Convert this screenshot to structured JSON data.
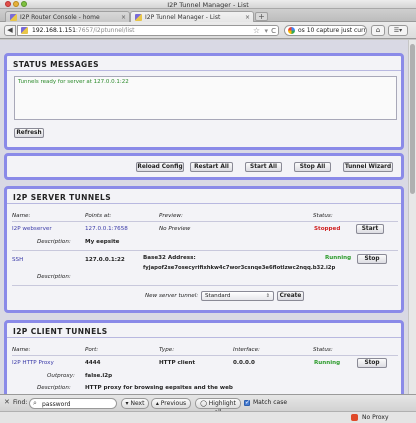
{
  "window": {
    "title": "I2P Tunnel Manager - List"
  },
  "tabs": [
    {
      "label": "I2P Router Console - home",
      "close": "×"
    },
    {
      "label": "I2P Tunnel Manager - List",
      "close": "×"
    }
  ],
  "new_tab": "+",
  "nav": {
    "back": "◀",
    "url_host": "192.168.1.151",
    "url_path": ":7657/i2ptunnel/list",
    "star": "☆",
    "arrow": "▾",
    "reload": "C",
    "search_text": "os 10 capture just curr",
    "home": "⌂",
    "menu": "☰▾"
  },
  "status": {
    "title": "STATUS MESSAGES",
    "message": "Tunnels ready for server at 127.0.0.1:22",
    "refresh": "Refresh"
  },
  "controls": {
    "buttons": [
      "Reload Config",
      "Restart All",
      "Start All",
      "Stop All",
      "Tunnel Wizard"
    ]
  },
  "server": {
    "title": "I2P SERVER TUNNELS",
    "headers": {
      "name": "Name:",
      "points": "Points at:",
      "preview": "Preview:",
      "status": "Status:"
    },
    "description_label": "Description:",
    "base32_label": "Base32 Address:",
    "rows": [
      {
        "name": "I2P webserver",
        "points": "127.0.0.1:7658",
        "preview": "No Preview",
        "status": "Stopped",
        "action": "Start",
        "description": "My eepsite"
      },
      {
        "name": "SSH",
        "points": "127.0.0.1:22",
        "status": "Running",
        "action": "Stop",
        "base32": "fyjapof2se7osecyrifixhkw4c7wor3csnqe3e6flotlzwc2nqq.b32.i2p",
        "description": ""
      }
    ],
    "new_label": "New server tunnel:",
    "new_select": "Standard",
    "create": "Create"
  },
  "client": {
    "title": "I2P CLIENT TUNNELS",
    "headers": {
      "name": "Name:",
      "port": "Port:",
      "type": "Type:",
      "interface": "Interface:",
      "status": "Status:"
    },
    "rows": [
      {
        "name": "I2P HTTP Proxy",
        "port": "4444",
        "type": "HTTP client",
        "interface": "0.0.0.0",
        "status": "Running",
        "action": "Stop",
        "outproxy_label": "Outproxy:",
        "outproxy": "false.i2p",
        "description_label": "Description:",
        "description": "HTTP proxy for browsing eepsites and the web"
      }
    ]
  },
  "findbar": {
    "close": "✕",
    "label": "Find:",
    "value": "password",
    "next": "Next",
    "previous": "Previous",
    "highlight": "Highlight all",
    "match_case": "Match case"
  },
  "statusbar": {
    "proxy": "No Proxy"
  },
  "colors": {
    "panel_border": "#8a8ae8",
    "running": "#2a9a2a",
    "stopped": "#d02020",
    "link": "#3a3aa8"
  }
}
